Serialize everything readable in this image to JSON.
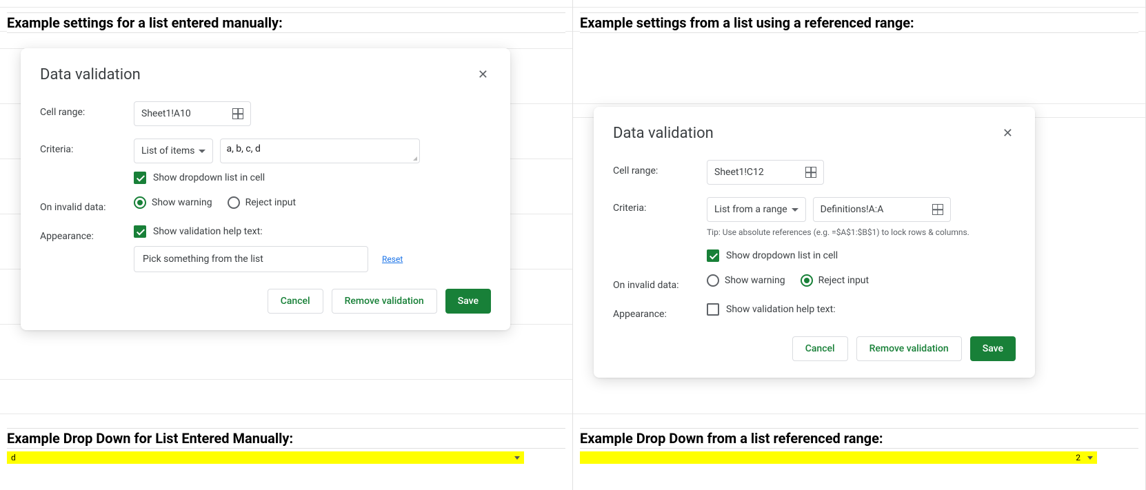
{
  "left": {
    "heading": "Example settings for a list entered manually:",
    "heading2": "Example Drop Down for List Entered Manually:",
    "yellow_value": "d",
    "dialog": {
      "title": "Data validation",
      "labels": {
        "cell_range": "Cell range:",
        "criteria": "Criteria:",
        "on_invalid": "On invalid data:",
        "appearance": "Appearance:"
      },
      "cell_range_value": "Sheet1!A10",
      "criteria_type": "List of items",
      "criteria_value": "a, b, c, d",
      "show_dropdown_label": "Show dropdown list in cell",
      "show_dropdown_checked": true,
      "warning_label": "Show warning",
      "reject_label": "Reject input",
      "warning_selected": true,
      "help_checked": true,
      "help_label": "Show validation help text:",
      "help_value": "Pick something from the list",
      "reset": "Reset",
      "buttons": {
        "cancel": "Cancel",
        "remove": "Remove validation",
        "save": "Save"
      }
    }
  },
  "right": {
    "heading": "Example settings from a list using a referenced range:",
    "heading2": "Example Drop Down from a list referenced range:",
    "yellow_value": "2",
    "dialog": {
      "title": "Data validation",
      "labels": {
        "cell_range": "Cell range:",
        "criteria": "Criteria:",
        "on_invalid": "On invalid data:",
        "appearance": "Appearance:"
      },
      "cell_range_value": "Sheet1!C12",
      "criteria_type": "List from a range",
      "criteria_value": "Definitions!A:A",
      "tip": "Tip: Use absolute references (e.g. =$A$1:$B$1) to lock rows & columns.",
      "show_dropdown_label": "Show dropdown list in cell",
      "show_dropdown_checked": true,
      "warning_label": "Show warning",
      "reject_label": "Reject input",
      "reject_selected": true,
      "help_checked": false,
      "help_label": "Show validation help text:",
      "buttons": {
        "cancel": "Cancel",
        "remove": "Remove validation",
        "save": "Save"
      }
    }
  }
}
